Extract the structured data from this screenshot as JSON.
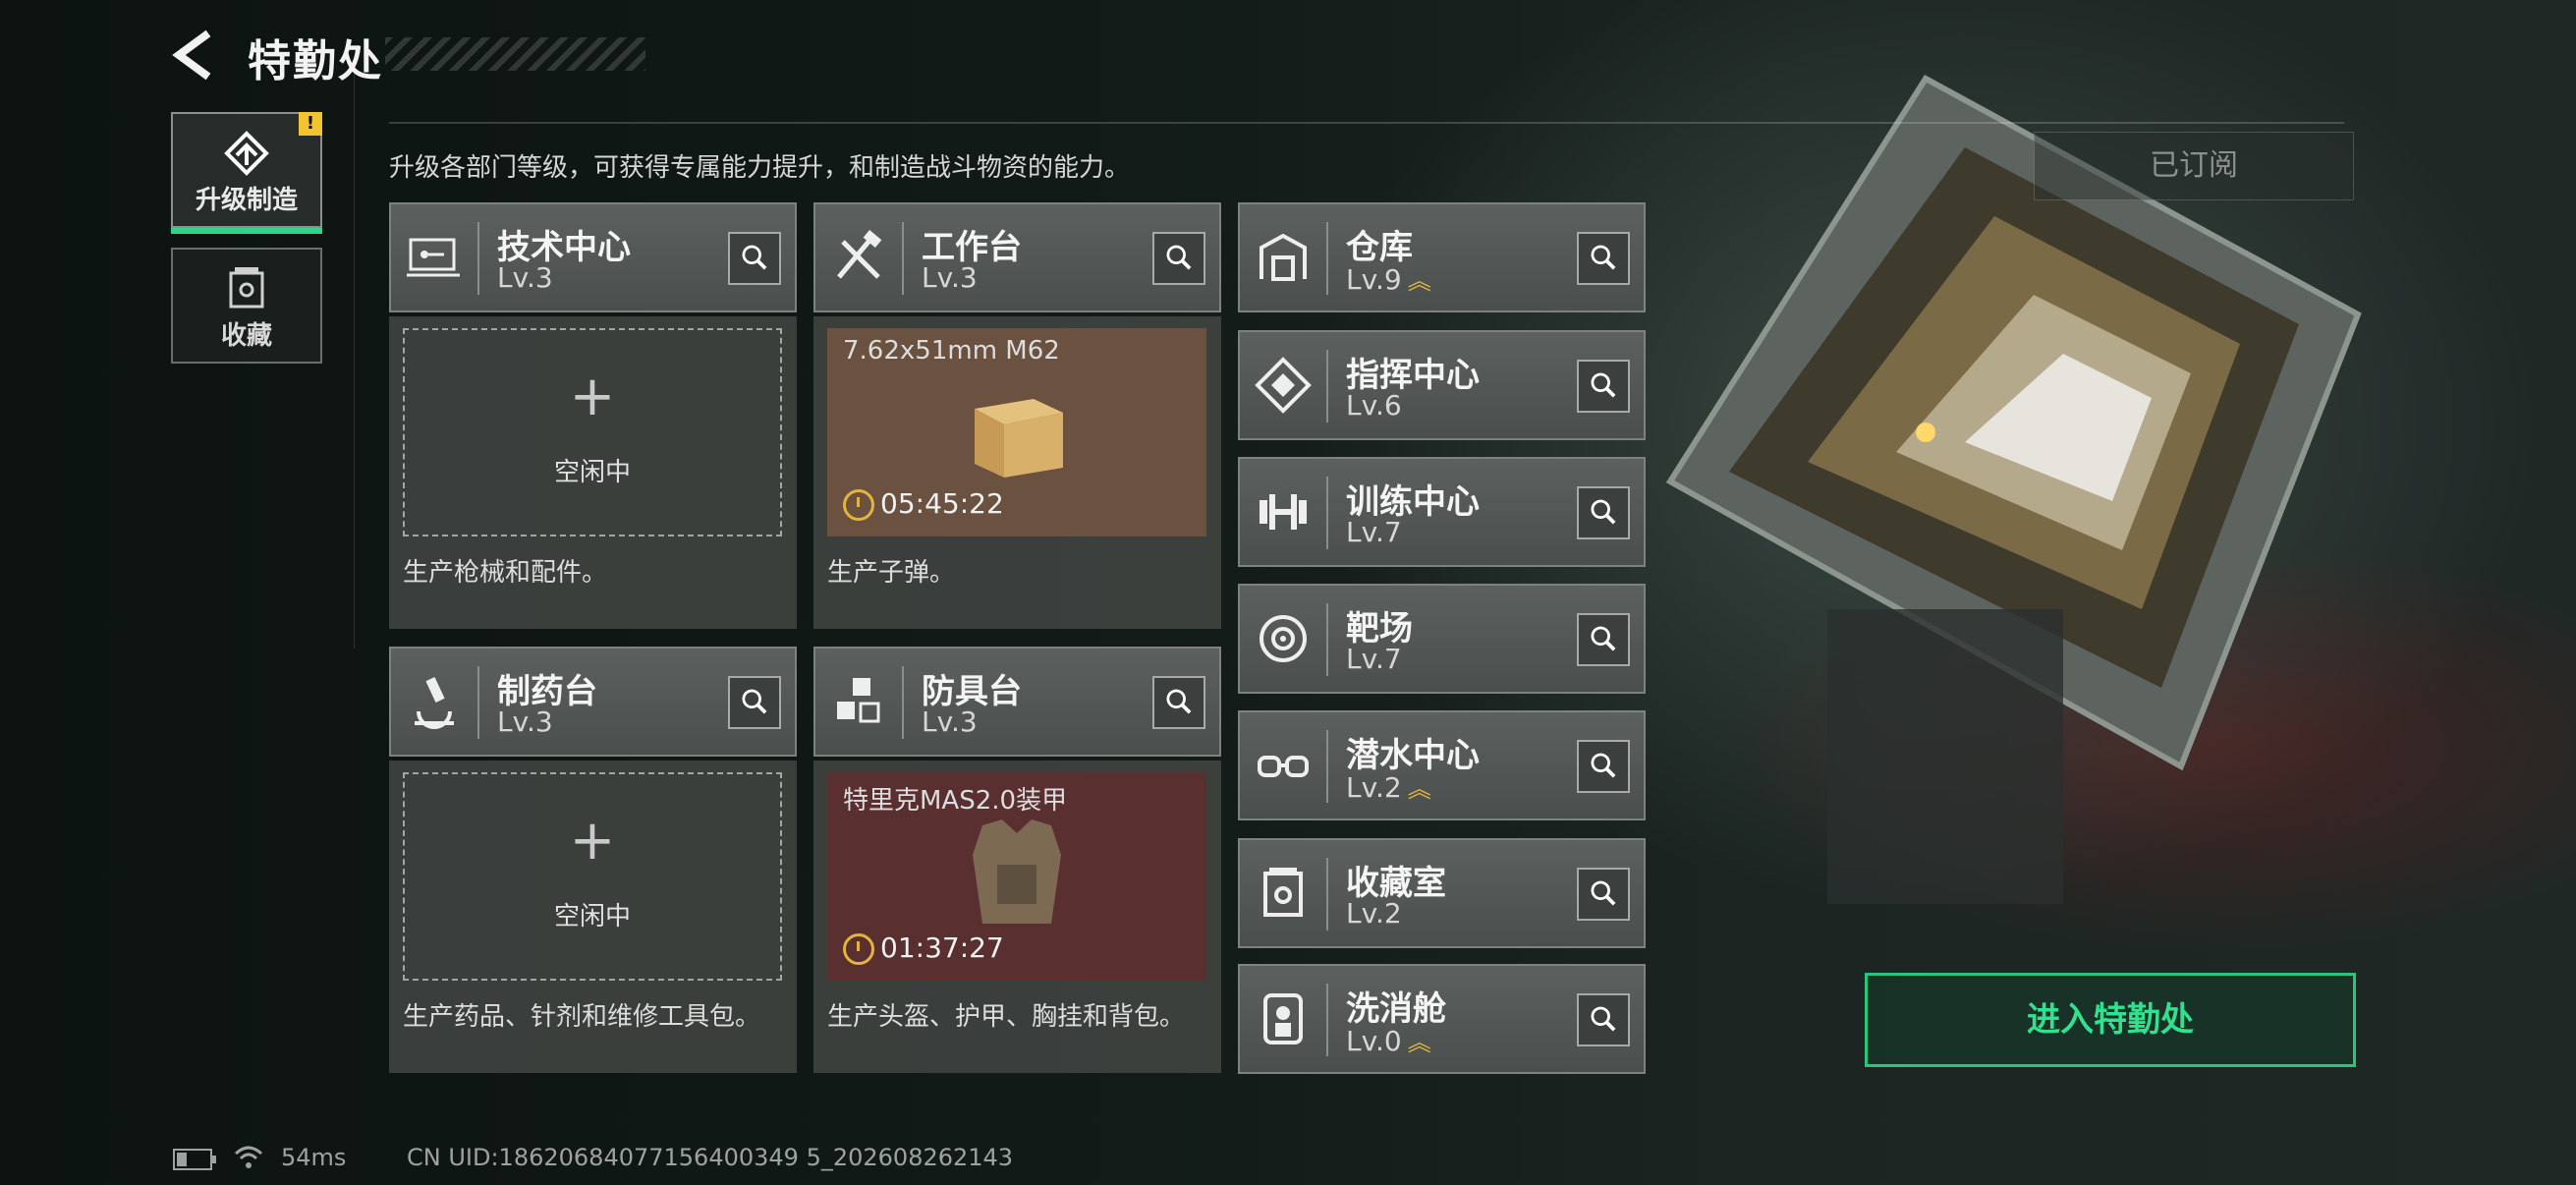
{
  "header": {
    "title": "特勤处"
  },
  "nav": [
    {
      "label": "升级制造",
      "active": true,
      "alert": "!"
    },
    {
      "label": "收藏",
      "active": false
    }
  ],
  "description": "升级各部门等级，可获得专属能力提升，和制造战斗物资的能力。",
  "stations_left": [
    {
      "name": "技术中心",
      "level": "Lv.3",
      "status": "idle",
      "idle_text": "空闲中",
      "note": "生产枪械和配件。",
      "icon": "circuit-board-icon"
    },
    {
      "name": "工作台",
      "level": "Lv.3",
      "status": "producing",
      "product": "7.62x51mm M62",
      "timer": "05:45:22",
      "note": "生产子弹。",
      "icon": "tools-icon",
      "bg": "#6b5140"
    },
    {
      "name": "制药台",
      "level": "Lv.3",
      "status": "idle",
      "idle_text": "空闲中",
      "note": "生产药品、针剂和维修工具包。",
      "icon": "microscope-icon"
    },
    {
      "name": "防具台",
      "level": "Lv.3",
      "status": "producing",
      "product": "特里克MAS2.0装甲",
      "timer": "01:37:27",
      "note": "生产头盔、护甲、胸挂和背包。",
      "icon": "armor-blocks-icon",
      "bg": "#5a2f30"
    }
  ],
  "stations_right": [
    {
      "name": "仓库",
      "level": "Lv.9",
      "upgradable": true,
      "icon": "warehouse-icon"
    },
    {
      "name": "指挥中心",
      "level": "Lv.6",
      "upgradable": false,
      "icon": "command-icon"
    },
    {
      "name": "训练中心",
      "level": "Lv.7",
      "upgradable": false,
      "icon": "dumbbell-icon"
    },
    {
      "name": "靶场",
      "level": "Lv.7",
      "upgradable": false,
      "icon": "target-icon"
    },
    {
      "name": "潜水中心",
      "level": "Lv.2",
      "upgradable": true,
      "icon": "diving-goggles-icon"
    },
    {
      "name": "收藏室",
      "level": "Lv.2",
      "upgradable": false,
      "icon": "collection-icon"
    },
    {
      "name": "洗消舱",
      "level": "Lv.0",
      "upgradable": true,
      "icon": "decontamination-icon"
    }
  ],
  "upgrade_glyph": "︽",
  "subscribed_label": "已订阅",
  "enter_button": "进入特勤处",
  "status_bar": {
    "ping": "54ms",
    "uid": "CN UID:18620684077156400349 5_202608262143"
  }
}
